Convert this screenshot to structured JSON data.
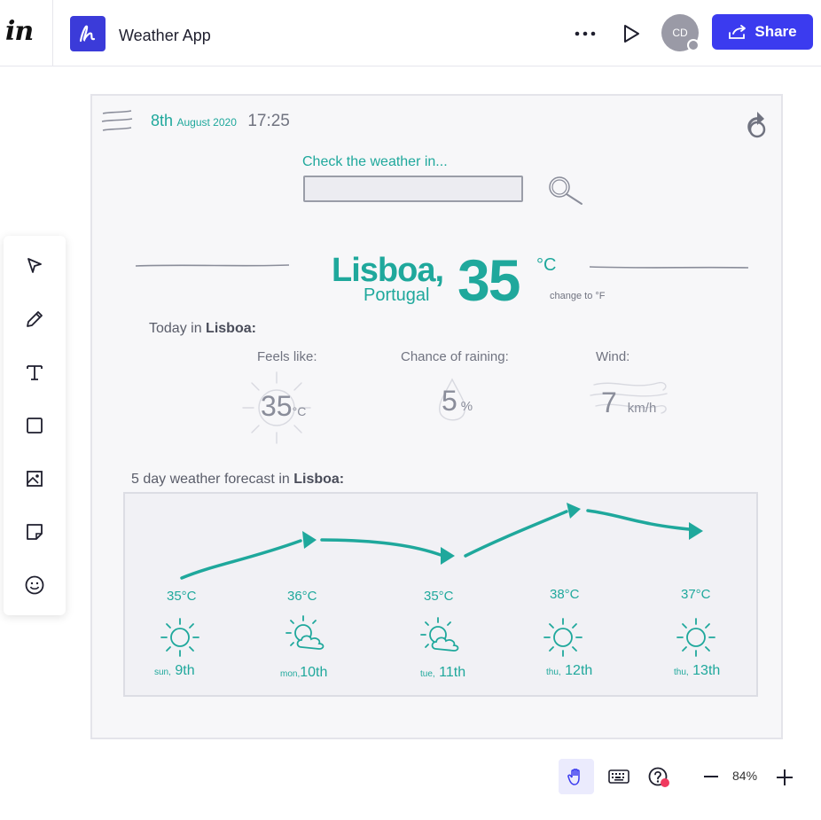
{
  "header": {
    "logo": "in",
    "app_title": "Weather App",
    "avatar_initials": "CD",
    "share_label": "Share"
  },
  "toolbar": {
    "tools": [
      "select-icon",
      "pencil-icon",
      "text-icon",
      "rectangle-icon",
      "image-icon",
      "sticky-note-icon",
      "emoji-icon"
    ]
  },
  "weather": {
    "date_day": "8th",
    "date_rest": "August 2020",
    "time": "17:25",
    "search_label": "Check the weather in...",
    "search_value": "",
    "city": "Lisboa,",
    "country": "Portugal",
    "temperature": "35",
    "unit": "°C",
    "change_unit": "change to °F",
    "today_prefix": "Today in ",
    "today_city": "Lisboa:",
    "feels_label": "Feels like:",
    "feels_value": "35",
    "feels_unit": "°C",
    "rain_label": "Chance of raining:",
    "rain_value": "5",
    "rain_unit": "%",
    "wind_label": "Wind:",
    "wind_value": "7",
    "wind_unit": "km/h",
    "forecast_prefix": "5 day weather forecast in ",
    "forecast_city": "Lisboa:",
    "forecast": [
      {
        "temp": "35°C",
        "day_short": "sun,",
        "day_num": "9th",
        "icon": "sun-icon"
      },
      {
        "temp": "36°C",
        "day_short": "mon,",
        "day_num": "10th",
        "icon": "sun-cloud-icon"
      },
      {
        "temp": "35°C",
        "day_short": "tue,",
        "day_num": "11th",
        "icon": "sun-cloud-icon"
      },
      {
        "temp": "38°C",
        "day_short": "thu,",
        "day_num": "12th",
        "icon": "sun-icon"
      },
      {
        "temp": "37°C",
        "day_short": "thu,",
        "day_num": "13th",
        "icon": "sun-icon"
      }
    ]
  },
  "bottom": {
    "zoom": "84%"
  },
  "colors": {
    "accent": "#1fa89c",
    "brand": "#3b3bef",
    "sketch": "#8a8d9a"
  }
}
